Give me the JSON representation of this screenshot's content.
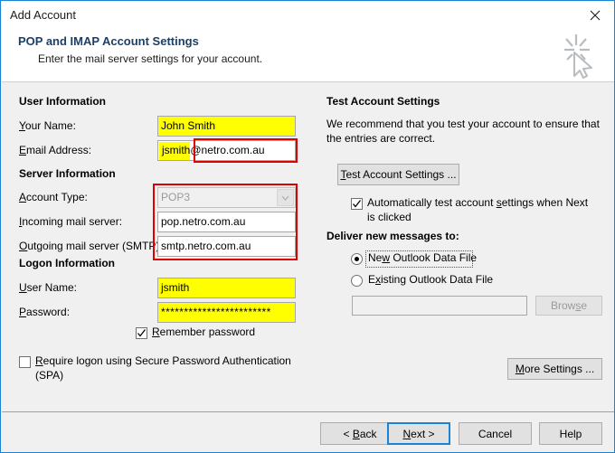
{
  "window": {
    "title": "Add Account",
    "close_icon": "close-icon"
  },
  "header": {
    "title": "POP and IMAP Account Settings",
    "subtitle": "Enter the mail server settings for your account.",
    "icon": "click-cursor-sparkle-icon"
  },
  "left": {
    "user_information_heading": "User Information",
    "your_name_label": "Your Name:",
    "your_name_value": "John Smith",
    "email_label": "Email Address:",
    "email_value_local": "jsmith",
    "email_value_domain": "@netro.com.au",
    "server_information_heading": "Server Information",
    "account_type_label": "Account Type:",
    "account_type_value": "POP3",
    "incoming_label": "Incoming mail server:",
    "incoming_value": "pop.netro.com.au",
    "outgoing_label": "Outgoing mail server (SMTP):",
    "outgoing_value": "smtp.netro.com.au",
    "logon_information_heading": "Logon Information",
    "user_name_label": "User Name:",
    "user_name_value": "jsmith",
    "password_label": "Password:",
    "password_value": "************************",
    "remember_password_label": "Remember password",
    "spa_label_line1": "Require logon using Secure Password Authentication",
    "spa_label_line2": "(SPA)"
  },
  "right": {
    "test_heading": "Test Account Settings",
    "test_paragraph_line1": "We recommend that you test your account to ensure that",
    "test_paragraph_line2": "the entries are correct.",
    "test_button_label": "Test Account Settings ...",
    "auto_test_line1": "Automatically test account settings when Next",
    "auto_test_line2": "is clicked",
    "deliver_heading": "Deliver new messages to:",
    "radio_new_label": "New Outlook Data File",
    "radio_existing_label": "Existing Outlook Data File",
    "path_value": "",
    "browse_label": "Browse",
    "more_settings_label": "More Settings ..."
  },
  "footer": {
    "back_label": "< Back",
    "next_label": "Next >",
    "cancel_label": "Cancel",
    "help_label": "Help"
  },
  "colors": {
    "window_border": "#1c82d2",
    "highlight_yellow": "#ffff00",
    "annotation_red": "#e00000",
    "header_title": "#1c3f66",
    "dialog_bg": "#f0f0f0"
  }
}
